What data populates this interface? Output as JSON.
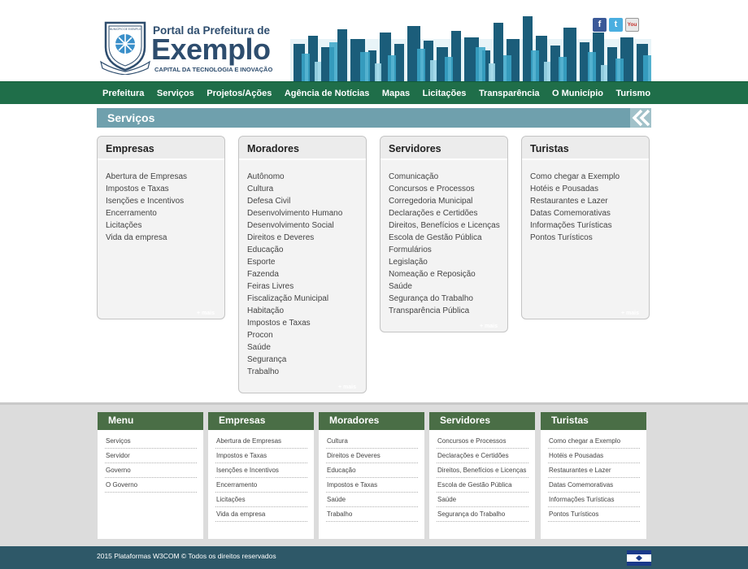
{
  "logo": {
    "line1": "Portal da Prefeitura de",
    "line2": "Exemplo",
    "line3": "CAPITAL DA TECNOLOGIA E INOVAÇÃO",
    "crest_text": "MUNICÍPIO DE EXEMPLO"
  },
  "social": {
    "facebook": "f",
    "twitter": "t",
    "youtube": "You"
  },
  "nav": [
    "Prefeitura",
    "Serviços",
    "Projetos/Ações",
    "Agência de Notícias",
    "Mapas",
    "Licitações",
    "Transparência",
    "O Município",
    "Turismo"
  ],
  "section": {
    "title": "Serviços"
  },
  "cards": [
    {
      "title": "Empresas",
      "items": [
        "Abertura de Empresas",
        "Impostos e Taxas",
        "Isenções e Incentivos",
        "Encerramento",
        "Licitações",
        "Vida da empresa"
      ],
      "more": "+ mais"
    },
    {
      "title": "Moradores",
      "items": [
        "Autônomo",
        "Cultura",
        "Defesa Civil",
        "Desenvolvimento Humano",
        "Desenvolvimento Social",
        "Direitos e Deveres",
        "Educação",
        "Esporte",
        "Fazenda",
        "Feiras Livres",
        "Fiscalização Municipal",
        "Habitação",
        "Impostos e Taxas",
        "Procon",
        "Saúde",
        "Segurança",
        "Trabalho"
      ],
      "more": "+ mais"
    },
    {
      "title": "Servidores",
      "items": [
        "Comunicação",
        "Concursos e Processos",
        "Corregedoria Municipal",
        "Declarações e Certidões",
        "Direitos, Benefícios e Licenças",
        "Escola de Gestão Pública",
        "Formulários",
        "Legislação",
        "Nomeação e Reposição",
        "Saúde",
        "Segurança do Trabalho",
        "Transparência Pública"
      ],
      "more": "+ mais"
    },
    {
      "title": "Turistas",
      "items": [
        "Como chegar a Exemplo",
        "Hotéis e Pousadas",
        "Restaurantes e Lazer",
        "Datas Comemorativas",
        "Informações Turísticas",
        "Pontos Turísticos"
      ],
      "more": "+ mais"
    }
  ],
  "footer_columns": [
    {
      "title": "Menu",
      "items": [
        "Serviços",
        "Servidor",
        "Governo",
        "O Governo"
      ]
    },
    {
      "title": "Empresas",
      "items": [
        "Abertura de Empresas",
        "Impostos e Taxas",
        "Isenções e Incentivos",
        "Encerramento",
        "Licitações",
        "Vida da empresa"
      ]
    },
    {
      "title": "Moradores",
      "items": [
        "Cultura",
        "Direitos e Deveres",
        "Educação",
        "Impostos e Taxas",
        "Saúde",
        "Trabalho"
      ]
    },
    {
      "title": "Servidores",
      "items": [
        "Concursos e Processos",
        "Declarações e Certidões",
        "Direitos, Benefícios e Licenças",
        "Escola de Gestão Pública",
        "Saúde",
        "Segurança do Trabalho"
      ]
    },
    {
      "title": "Turistas",
      "items": [
        "Como chegar a Exemplo",
        "Hotéis e Pousadas",
        "Restaurantes e Lazer",
        "Datas Comemorativas",
        "Informações Turísticas",
        "Pontos Turísticos"
      ]
    }
  ],
  "copyright": "2015 Plataformas W3COM © Todos os direitos reservados",
  "colors": {
    "nav_green": "#1f6e49",
    "footer_head_green": "#4a6e46",
    "section_teal": "#6fa0ad",
    "bottom_bar": "#2e5868",
    "logo_navy": "#2e4d6e"
  }
}
